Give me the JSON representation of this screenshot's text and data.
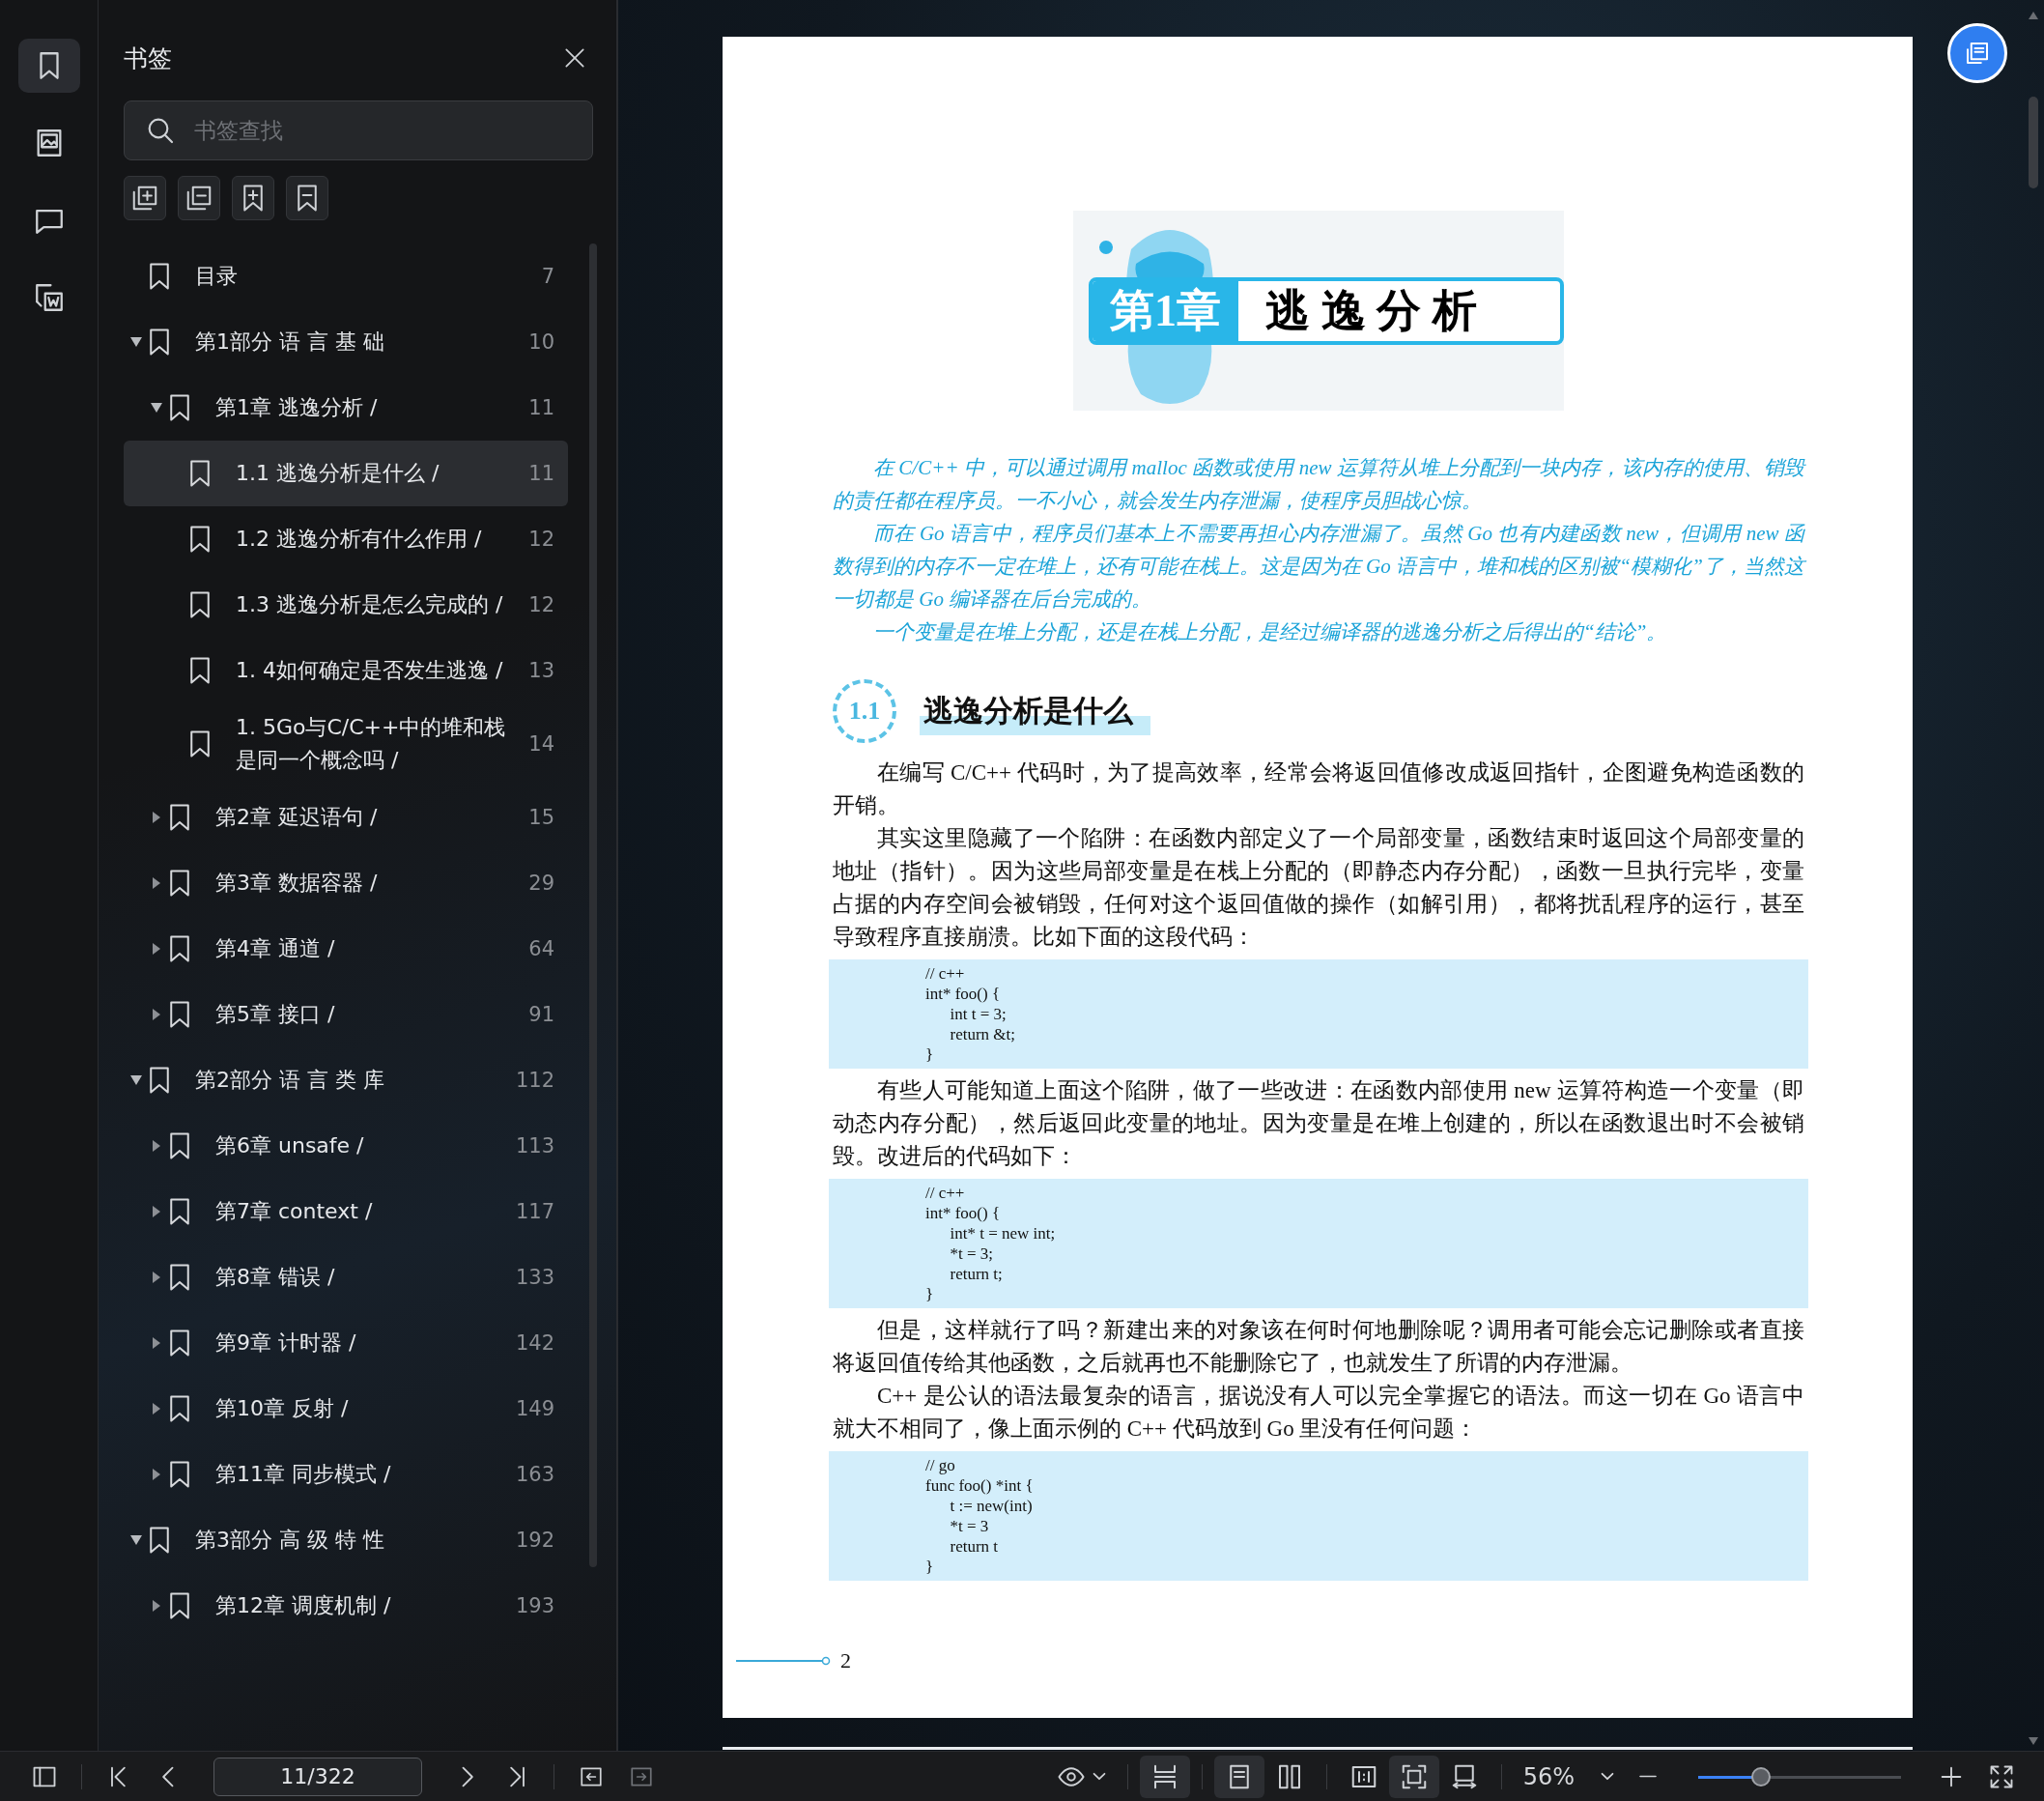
{
  "rail": {
    "items": [
      {
        "kind": "bookmark",
        "selected": true
      },
      {
        "kind": "image",
        "selected": false
      },
      {
        "kind": "comment",
        "selected": false
      },
      {
        "kind": "export",
        "selected": false
      }
    ]
  },
  "sidebar": {
    "title": "书签",
    "search": {
      "placeholder": "书签查找"
    },
    "tree": [
      {
        "label": "目录",
        "page": "7",
        "selected": false
      },
      {
        "label": "第1部分 语 言 基 础",
        "page": "10",
        "selected": false,
        "expanded": true,
        "children": [
          {
            "label": "第1章 逃逸分析 /",
            "page": "11",
            "selected": false,
            "expanded": true,
            "children": [
              {
                "label": "1.1 逃逸分析是什么 /",
                "page": "11",
                "selected": true
              },
              {
                "label": "1.2 逃逸分析有什么作用 /",
                "page": "12",
                "selected": false
              },
              {
                "label": "1.3 逃逸分析是怎么完成的 /",
                "page": "12",
                "selected": false
              },
              {
                "label": "1. 4如何确定是否发生逃逸 /",
                "page": "13",
                "selected": false
              },
              {
                "label": "1. 5Go与C/C++中的堆和栈是同一个概念吗 /",
                "page": "14",
                "selected": false
              }
            ]
          },
          {
            "label": "第2章 延迟语句 /",
            "page": "15",
            "selected": false,
            "expanded": false
          },
          {
            "label": "第3章 数据容器 /",
            "page": "29",
            "selected": false,
            "expanded": false
          },
          {
            "label": "第4章 通道 /",
            "page": "64",
            "selected": false,
            "expanded": false
          },
          {
            "label": "第5章 接口 /",
            "page": "91",
            "selected": false,
            "expanded": false
          }
        ]
      },
      {
        "label": "第2部分 语 言 类 库",
        "page": "112",
        "selected": false,
        "expanded": true,
        "children": [
          {
            "label": "第6章 unsafe /",
            "page": "113",
            "selected": false,
            "expanded": false
          },
          {
            "label": "第7章 context /",
            "page": "117",
            "selected": false,
            "expanded": false
          },
          {
            "label": "第8章 错误 /",
            "page": "133",
            "selected": false,
            "expanded": false
          },
          {
            "label": "第9章 计时器 /",
            "page": "142",
            "selected": false,
            "expanded": false
          },
          {
            "label": "第10章 反射 /",
            "page": "149",
            "selected": false,
            "expanded": false
          },
          {
            "label": "第11章 同步模式 /",
            "page": "163",
            "selected": false,
            "expanded": false
          }
        ]
      },
      {
        "label": "第3部分 高 级 特 性",
        "page": "192",
        "selected": false,
        "expanded": true,
        "children": [
          {
            "label": "第12章 调度机制 /",
            "page": "193",
            "selected": false,
            "expanded": false
          }
        ]
      }
    ]
  },
  "page": {
    "chapter_banner": {
      "number": "第1章",
      "title": "逃 逸 分 析"
    },
    "intro": [
      "在 C/C++ 中，可以通过调用 malloc 函数或使用 new 运算符从堆上分配到一块内存，该内存的使用、销毁的责任都在程序员。一不小心，就会发生内存泄漏，使程序员胆战心惊。",
      "而在 Go 语言中，程序员们基本上不需要再担心内存泄漏了。虽然 Go 也有内建函数 new，但调用 new 函数得到的内存不一定在堆上，还有可能在栈上。这是因为在 Go 语言中，堆和栈的区别被“模糊化”了，当然这一切都是 Go 编译器在后台完成的。",
      "一个变量是在堆上分配，还是在栈上分配，是经过编译器的逃逸分析之后得出的“结论”。"
    ],
    "section": {
      "number": "1.1",
      "title": "逃逸分析是什么"
    },
    "blocks": [
      {
        "kind": "paragraph",
        "text": "在编写 C/C++ 代码时，为了提高效率，经常会将返回值修改成返回指针，企图避免构造函数的开销。"
      },
      {
        "kind": "paragraph",
        "text": "其实这里隐藏了一个陷阱：在函数内部定义了一个局部变量，函数结束时返回这个局部变量的地址（指针）。因为这些局部变量是在栈上分配的（即静态内存分配），函数一旦执行完毕，变量占据的内存空间会被销毁，任何对这个返回值做的操作（如解引用），都将扰乱程序的运行，甚至导致程序直接崩溃。比如下面的这段代码："
      },
      {
        "kind": "code",
        "lines": [
          "// c++",
          "int* foo() {",
          "      int t = 3;",
          "      return &t;",
          "}"
        ]
      },
      {
        "kind": "paragraph",
        "text": "有些人可能知道上面这个陷阱，做了一些改进：在函数内部使用 new 运算符构造一个变量（即动态内存分配），然后返回此变量的地址。因为变量是在堆上创建的，所以在函数退出时不会被销毁。改进后的代码如下："
      },
      {
        "kind": "code",
        "lines": [
          "// c++",
          "int* foo() {",
          "      int* t = new int;",
          "      *t = 3;",
          "      return t;",
          "}"
        ]
      },
      {
        "kind": "paragraph",
        "text": "但是，这样就行了吗？新建出来的对象该在何时何地删除呢？调用者可能会忘记删除或者直接将返回值传给其他函数，之后就再也不能删除它了，也就发生了所谓的内存泄漏。"
      },
      {
        "kind": "paragraph",
        "text": "C++ 是公认的语法最复杂的语言，据说没有人可以完全掌握它的语法。而这一切在 Go 语言中就大不相同了，像上面示例的 C++ 代码放到 Go 里没有任何问题："
      },
      {
        "kind": "code",
        "lines": [
          "// go",
          "func foo() *int {",
          "      t := new(int)",
          "      *t = 3",
          "      return t",
          "}"
        ]
      }
    ],
    "page_number": "2"
  },
  "toolbar": {
    "page_field": {
      "value": "11/322"
    },
    "nav_buttons": [
      {
        "kind": "back",
        "disabled": false
      },
      {
        "kind": "forward",
        "disabled": true
      }
    ],
    "view_buttons": [
      {
        "kind": "fit-width",
        "selected": true
      },
      {
        "kind": "single-page",
        "selected": true
      },
      {
        "kind": "two-page",
        "selected": false
      },
      {
        "kind": "actual-size",
        "selected": false
      },
      {
        "kind": "fit-page",
        "selected": true
      },
      {
        "kind": "rotate",
        "selected": false
      }
    ],
    "zoom": {
      "value": "56%"
    },
    "zoom_slider": {
      "level": 0.31
    }
  }
}
